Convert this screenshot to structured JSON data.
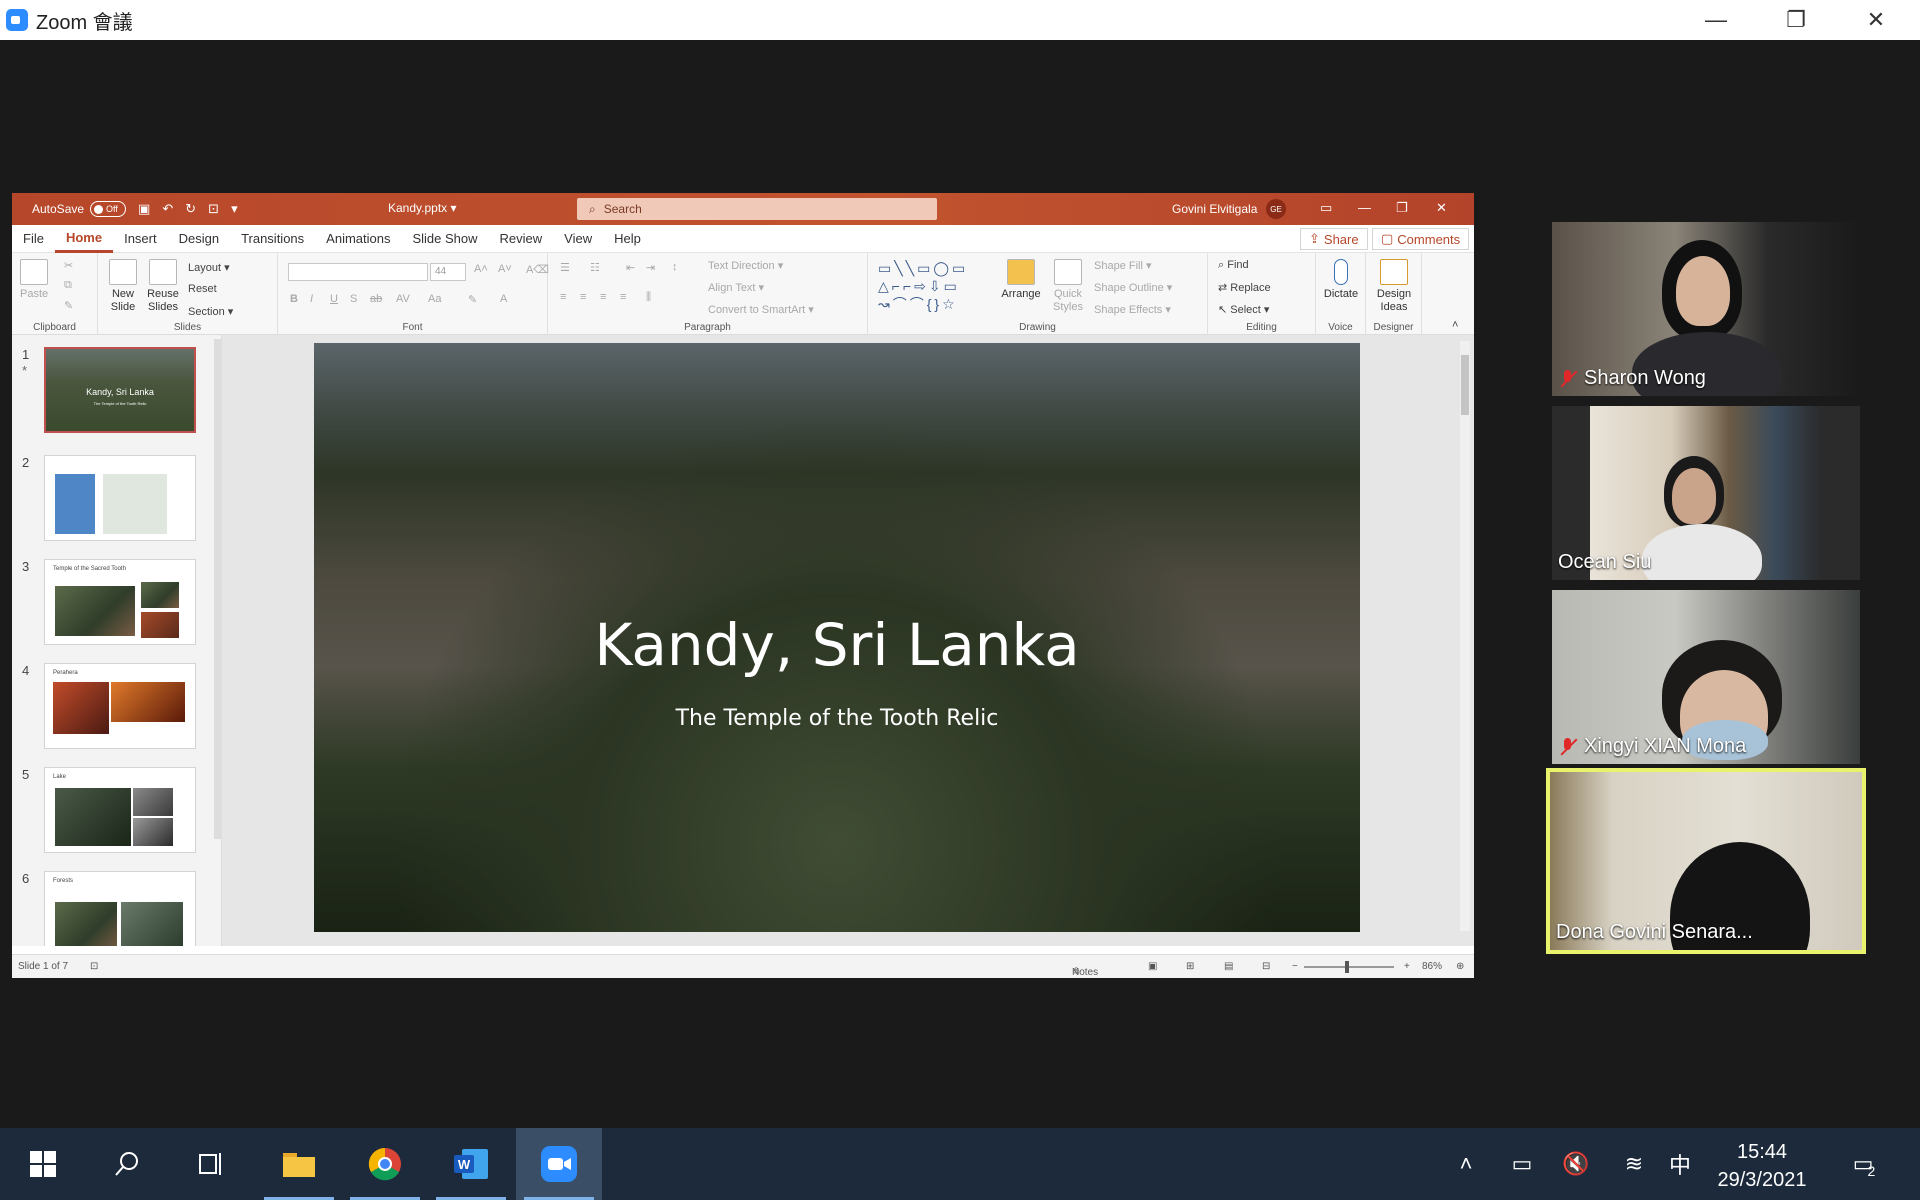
{
  "zoom": {
    "title": "Zoom 會議",
    "minimize": "—",
    "restore": "❐",
    "close": "✕"
  },
  "ppt": {
    "autosave_label": "AutoSave",
    "autosave_state": "Off",
    "doc_title": "Kandy.pptx ▾",
    "search_placeholder": "Search",
    "user_name": "Govini Elvitigala",
    "user_initials": "GE",
    "tabs": [
      "File",
      "Home",
      "Insert",
      "Design",
      "Transitions",
      "Animations",
      "Slide Show",
      "Review",
      "View",
      "Help"
    ],
    "share_label": "Share",
    "comments_label": "Comments",
    "ribbon": {
      "clipboard": {
        "label": "Clipboard",
        "paste": "Paste"
      },
      "slides": {
        "label": "Slides",
        "new_slide": "New Slide",
        "reuse_slides": "Reuse Slides",
        "layout": "Layout ▾",
        "reset": "Reset",
        "section": "Section ▾"
      },
      "font": {
        "label": "Font",
        "size": "44"
      },
      "paragraph": {
        "label": "Paragraph",
        "text_direction": "Text Direction ▾",
        "align_text": "Align Text ▾",
        "convert_smartart": "Convert to SmartArt ▾"
      },
      "drawing": {
        "label": "Drawing",
        "arrange": "Arrange",
        "quick_styles": "Quick Styles",
        "shape_fill": "Shape Fill ▾",
        "shape_outline": "Shape Outline ▾",
        "shape_effects": "Shape Effects ▾"
      },
      "editing": {
        "label": "Editing",
        "find": "Find",
        "replace": "Replace",
        "select": "Select ▾"
      },
      "voice": {
        "label": "Voice",
        "dictate": "Dictate"
      },
      "designer": {
        "label": "Designer",
        "design_ideas": "Design Ideas"
      }
    },
    "thumbnails": [
      {
        "num": "1",
        "title": "Kandy, Sri Lanka",
        "subtitle": "The Temple of the Tooth Relic"
      },
      {
        "num": "2",
        "title": ""
      },
      {
        "num": "3",
        "title": "Temple of the Sacred Tooth"
      },
      {
        "num": "4",
        "title": "Perahera"
      },
      {
        "num": "5",
        "title": "Lake"
      },
      {
        "num": "6",
        "title": "Forests"
      }
    ],
    "slide": {
      "title": "Kandy, Sri Lanka",
      "subtitle": "The Temple of the Tooth Relic"
    },
    "status": {
      "slide_of": "Slide 1 of 7",
      "notes": "Notes",
      "zoom": "86%"
    }
  },
  "participants": [
    {
      "name": "Sharon Wong",
      "muted": true
    },
    {
      "name": "Ocean Siu",
      "muted": false
    },
    {
      "name": "Xingyi XIAN Mona",
      "muted": true
    },
    {
      "name": "Dona Govini Senara...",
      "muted": false,
      "speaking": true
    }
  ],
  "taskbar": {
    "time": "15:44",
    "date": "29/3/2021",
    "ime": "中",
    "notifications": "2"
  },
  "colors": {
    "ppt_accent": "#b7472a",
    "zoom_blue": "#2d8cff",
    "speaker_border": "#e8f36b",
    "taskbar": "#1c2a3b"
  }
}
